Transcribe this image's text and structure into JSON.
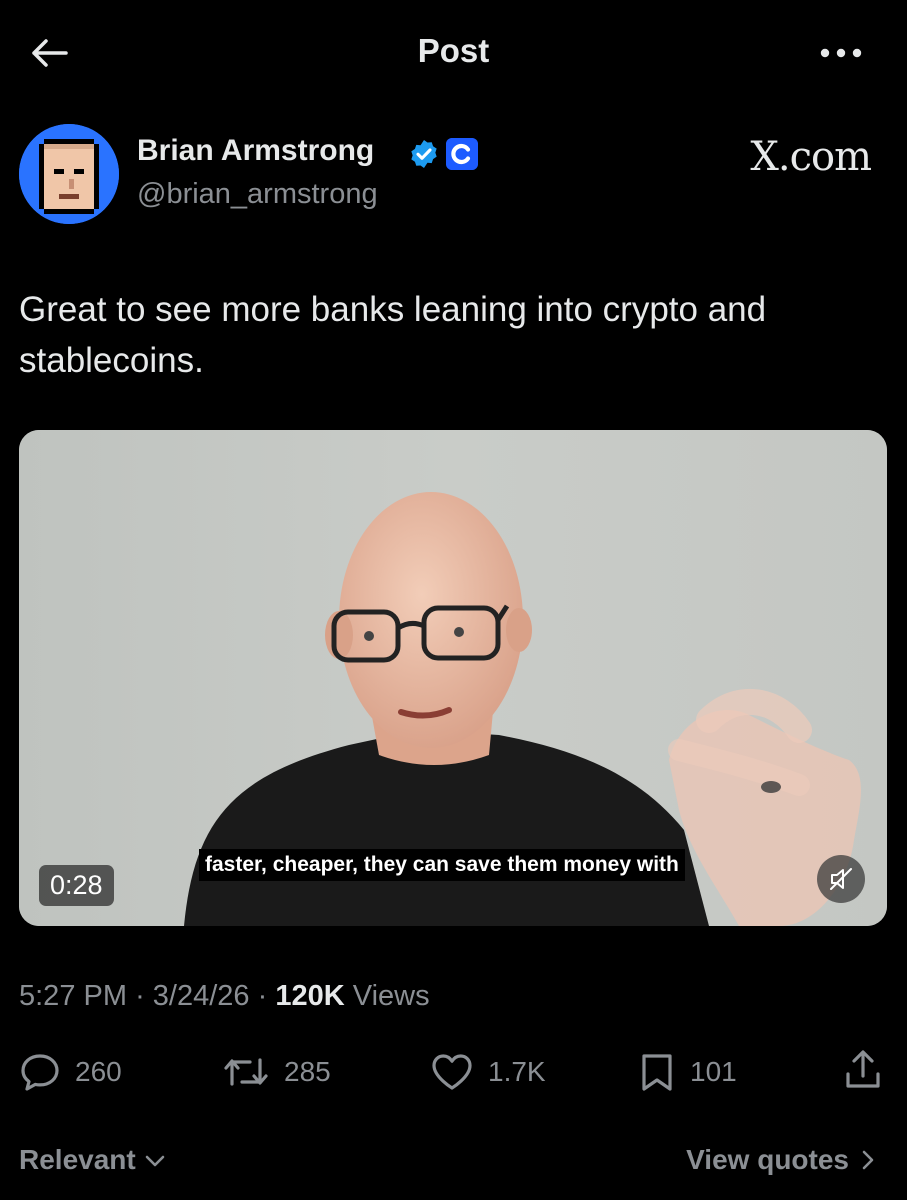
{
  "header": {
    "title": "Post",
    "back_icon": "arrow-left-icon",
    "more_icon": "ellipsis-icon"
  },
  "author": {
    "name": "Brian Armstrong",
    "handle": "@brian_armstrong",
    "verified_icon": "verified-badge-icon",
    "org_badge_icon": "coinbase-logo-icon",
    "brand_color": "#1d9bf0"
  },
  "source_tag": "X.com",
  "post": {
    "text": "Great to see more banks leaning into crypto and stablecoins."
  },
  "video": {
    "duration": "0:28",
    "caption": "faster, cheaper, they can save them money with",
    "mute_icon": "speaker-muted-icon"
  },
  "meta": {
    "time": "5:27 PM",
    "separator": "·",
    "date": "3/24/26",
    "views_count": "120K",
    "views_label": "Views"
  },
  "actions": {
    "replies": "260",
    "reposts": "285",
    "likes": "1.7K",
    "bookmarks": "101"
  },
  "footer": {
    "sort_label": "Relevant",
    "quotes_label": "View quotes"
  }
}
